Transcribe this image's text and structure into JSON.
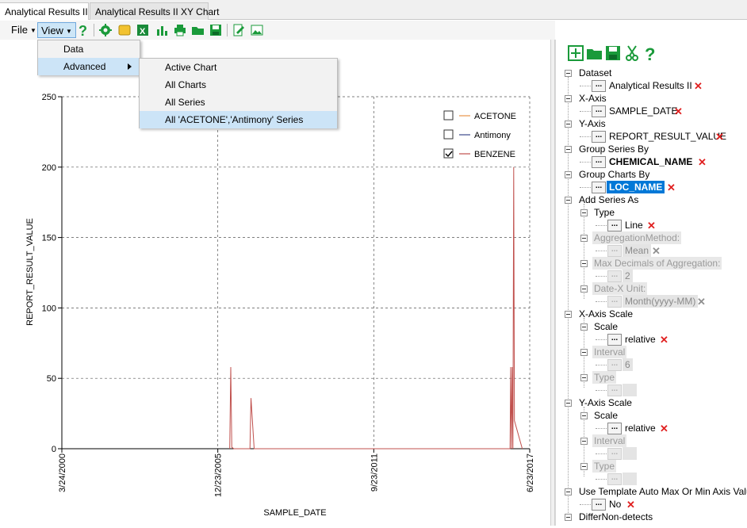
{
  "tabs": [
    "Analytical Results II",
    "Analytical Results II XY Chart"
  ],
  "menubar": {
    "file": "File",
    "view": "View"
  },
  "view_menu": {
    "items": [
      "Data",
      "Advanced"
    ],
    "advanced_submenu": [
      "Active Chart",
      "All Charts",
      "All Series",
      "All 'ACETONE','Antimony' Series"
    ]
  },
  "chart_data": {
    "type": "line",
    "xlabel": "SAMPLE_DATE",
    "ylabel": "REPORT_RESULT_VALUE",
    "x_ticks": [
      "3/24/2000",
      "12/23/2005",
      "9/23/2011",
      "6/23/2017"
    ],
    "y_ticks": [
      "0",
      "50",
      "100",
      "150",
      "200",
      "250"
    ],
    "ylim": [
      0,
      250
    ],
    "xlim": [
      "3/24/2000",
      "6/23/2017"
    ],
    "grid": true,
    "legend_position": "top-right",
    "series": [
      {
        "name": "ACETONE",
        "color": "#e8944a",
        "checked": false,
        "points": []
      },
      {
        "name": "Antimony",
        "color": "#3b4a8a",
        "checked": false,
        "points": []
      },
      {
        "name": "BENZENE",
        "color": "#c0504d",
        "checked": true,
        "points": [
          [
            "6/1/2006",
            0
          ],
          [
            "6/15/2006",
            58
          ],
          [
            "6/29/2006",
            1
          ],
          [
            "7/27/2006",
            0
          ],
          [
            "3/1/2007",
            0
          ],
          [
            "3/15/2007",
            36
          ],
          [
            "4/26/2007",
            0
          ],
          [
            "10/1/2016",
            0
          ],
          [
            "10/10/2016",
            58
          ],
          [
            "10/20/2016",
            0
          ],
          [
            "10/30/2016",
            58
          ],
          [
            "11/9/2016",
            0
          ],
          [
            "11/19/2016",
            200
          ],
          [
            "11/29/2016",
            20
          ],
          [
            "3/15/2017",
            0
          ]
        ]
      }
    ]
  },
  "panel": {
    "tree": [
      {
        "label": "Dataset",
        "value": "Analytical Results II",
        "style": "normal",
        "x": "red"
      },
      {
        "label": "X-Axis",
        "value": "SAMPLE_DATE",
        "style": "normal",
        "x": "red"
      },
      {
        "label": "Y-Axis",
        "value": "REPORT_RESULT_VALUE",
        "style": "normal",
        "x": "red"
      },
      {
        "label": "Group Series By",
        "value": "CHEMICAL_NAME",
        "style": "bold",
        "x": "red"
      },
      {
        "label": "Group Charts By",
        "value": "LOC_NAME",
        "style": "selected",
        "x": "red"
      }
    ],
    "add_series_as": {
      "label": "Add Series As",
      "children": [
        {
          "label": "Type",
          "value": "Line",
          "disabled": false
        },
        {
          "label": "AggregationMethod:",
          "value": "Mean",
          "disabled": true
        },
        {
          "label": "Max Decimals of Aggregation:",
          "value": "2",
          "disabled": true
        },
        {
          "label": "Date-X Unit:",
          "value": "Month(yyyy-MM)",
          "disabled": true
        }
      ]
    },
    "x_axis_scale": {
      "label": "X-Axis Scale",
      "children": [
        {
          "label": "Scale",
          "value": "relative",
          "disabled": false
        },
        {
          "label": "Interval",
          "value": "6",
          "disabled": true
        },
        {
          "label": "Type",
          "value": "",
          "disabled": true
        }
      ]
    },
    "y_axis_scale": {
      "label": "Y-Axis Scale",
      "children": [
        {
          "label": "Scale",
          "value": "relative",
          "disabled": false
        },
        {
          "label": "Interval",
          "value": "",
          "disabled": true
        },
        {
          "label": "Type",
          "value": "",
          "disabled": true
        }
      ]
    },
    "template_auto": {
      "label": "Use Template Auto Max Or Min Axis Value",
      "value": "No"
    },
    "differ_nondetects": {
      "label": "DifferNon-detects"
    },
    "button_dots": "..."
  }
}
